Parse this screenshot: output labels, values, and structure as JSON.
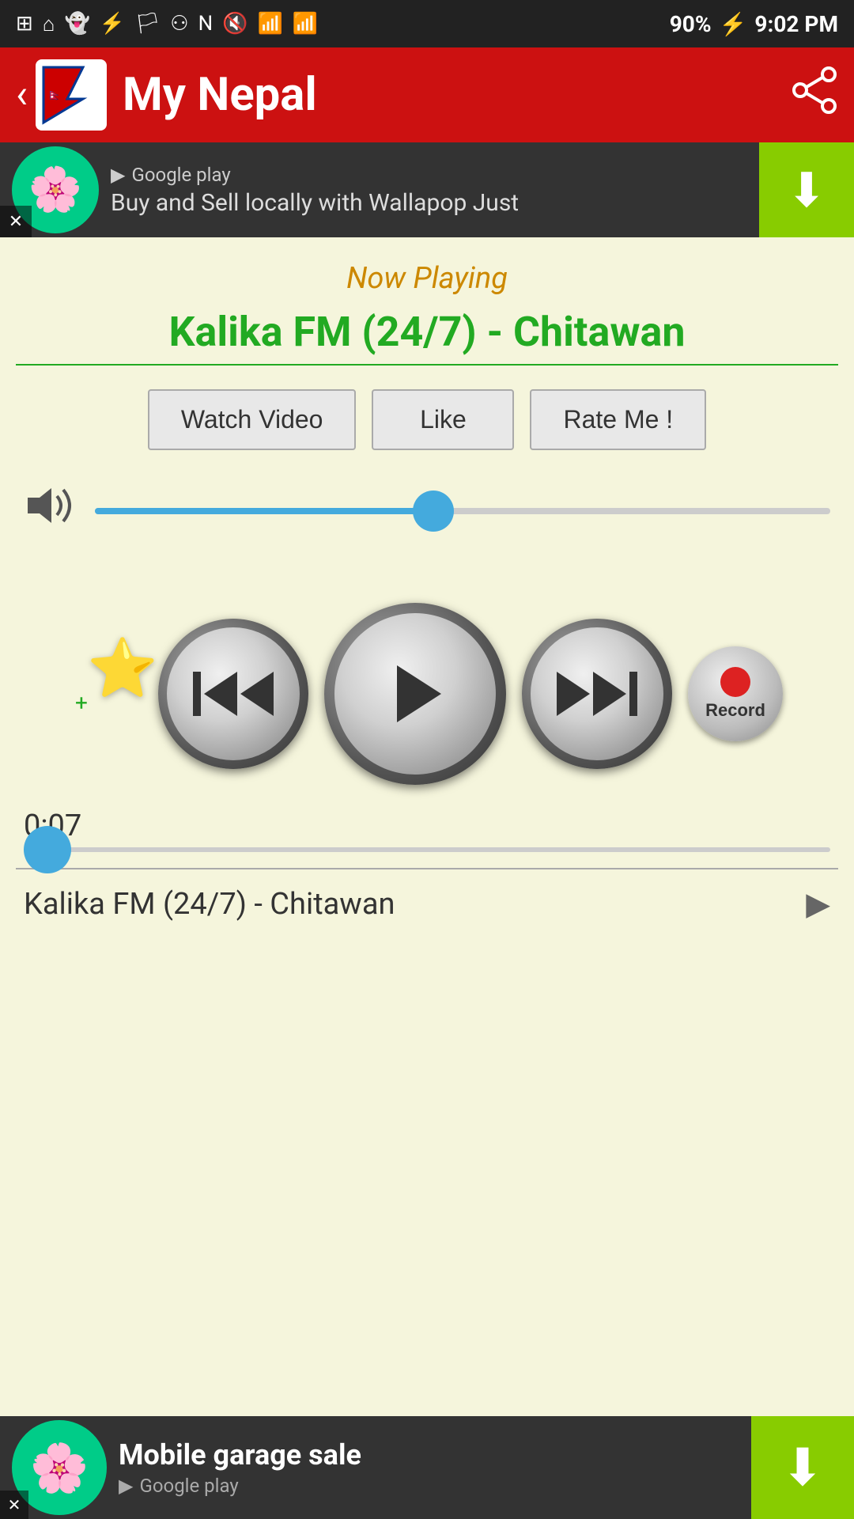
{
  "statusBar": {
    "time": "9:02 PM",
    "battery": "90%",
    "signal": "strong"
  },
  "appBar": {
    "title": "My Nepal",
    "backLabel": "‹"
  },
  "ads": {
    "top": {
      "text": "Buy and Sell locally with Wallapop Just",
      "googlePlay": "Google play"
    },
    "bottom": {
      "title": "Mobile garage sale",
      "googlePlay": "Google play"
    }
  },
  "player": {
    "nowPlayingLabel": "Now Playing",
    "stationName": "Kalika FM (24/7) - Chitawan",
    "watchVideoLabel": "Watch Video",
    "likeLabel": "Like",
    "rateMeLabel": "Rate Me !",
    "timeDisplay": "0:07",
    "trackTitle": "Kalika FM (24/7) - Chitawan",
    "volumePercent": 46,
    "progressPercent": 4,
    "controls": {
      "prevLabel": "Previous",
      "playLabel": "Play",
      "nextLabel": "Next",
      "recordLabel": "Record"
    }
  }
}
